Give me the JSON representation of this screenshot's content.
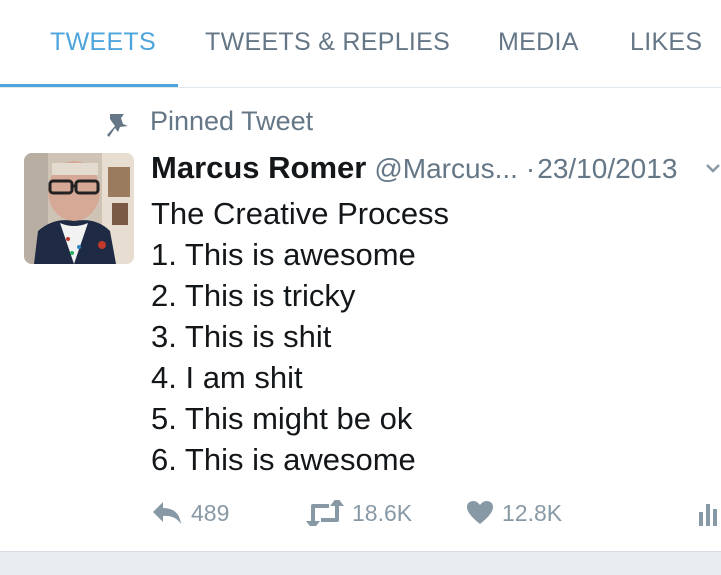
{
  "tabs": [
    {
      "label": "TWEETS",
      "active": true
    },
    {
      "label": "TWEETS & REPLIES",
      "active": false
    },
    {
      "label": "MEDIA",
      "active": false
    },
    {
      "label": "LIKES",
      "active": false
    }
  ],
  "pinned": {
    "label": "Pinned Tweet",
    "icon": "pin-icon"
  },
  "tweet": {
    "author_name": "Marcus Romer",
    "handle": "@Marcus...",
    "separator": "·",
    "date": "23/10/2013",
    "lines": [
      "The Creative Process",
      "1. This is awesome",
      "2. This is tricky",
      "3. This is shit",
      "4. I am shit",
      "5. This might be ok",
      "6. This is awesome"
    ],
    "actions": {
      "replies": "489",
      "retweets": "18.6K",
      "likes": "12.8K"
    }
  },
  "colors": {
    "accent": "#4ea4dc",
    "muted": "#657786",
    "text": "#14171a",
    "action": "#8899a6"
  }
}
